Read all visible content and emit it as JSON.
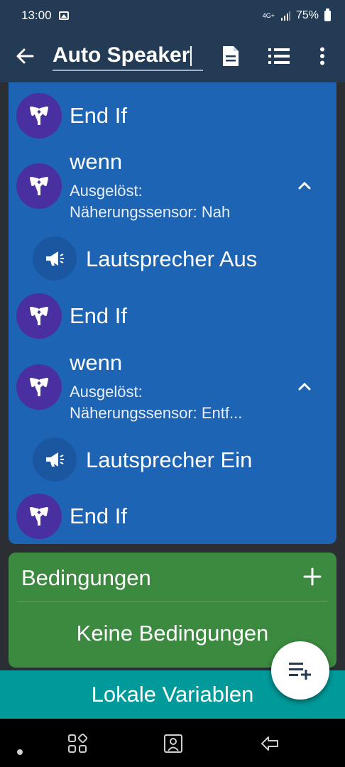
{
  "status_bar": {
    "time": "13:00",
    "network": "4G+",
    "battery": "75%"
  },
  "app_bar": {
    "macro_name": "Auto Speaker"
  },
  "macro_rows": [
    {
      "kind": "endif",
      "label": "End If"
    },
    {
      "kind": "if",
      "label": "wenn",
      "trigger_line": "Ausgelöst:",
      "condition_line": "Näherungssensor: Nah"
    },
    {
      "kind": "action",
      "label": "Lautsprecher Aus"
    },
    {
      "kind": "endif",
      "label": "End If"
    },
    {
      "kind": "if",
      "label": "wenn",
      "trigger_line": "Ausgelöst:",
      "condition_line": "Näherungssensor: Entf..."
    },
    {
      "kind": "action",
      "label": "Lautsprecher Ein"
    },
    {
      "kind": "endif",
      "label": "End If"
    }
  ],
  "conditions": {
    "title": "Bedingungen",
    "empty_label": "Keine Bedingungen"
  },
  "local_variables": {
    "label": "Lokale Variablen"
  },
  "colors": {
    "appbar": "#243b55",
    "macro_panel": "#1e64b4",
    "condition_icon": "#4a2fa0",
    "conditions_panel": "#3b8a40",
    "local_variables": "#009a9a"
  }
}
